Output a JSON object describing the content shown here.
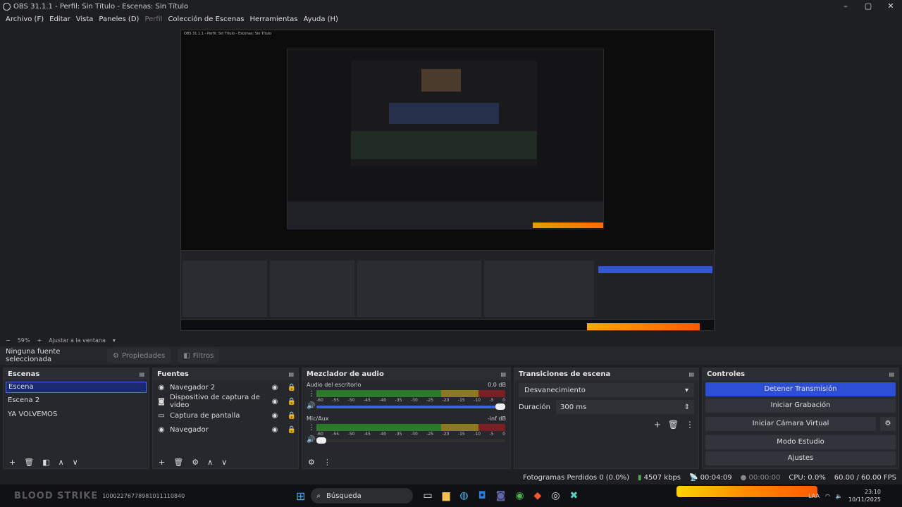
{
  "window": {
    "title": "OBS 31.1.1 - Perfil: Sin Título - Escenas: Sin Título",
    "controls": [
      "–",
      "▢",
      "✕"
    ]
  },
  "menu": [
    "Archivo (F)",
    "Editar",
    "Vista",
    "Paneles (D)",
    "Perfil",
    "Colección de Escenas",
    "Herramientas",
    "Ayuda (H)"
  ],
  "preview_bar": {
    "zoom": "59%",
    "fit": "Ajustar a la ventana"
  },
  "source_bar": {
    "no_source": "Ninguna fuente seleccionada",
    "properties": "Propiedades",
    "filters": "Filtros"
  },
  "scenes": {
    "title": "Escenas",
    "items": [
      "Escena",
      "Escena 2",
      "YA VOLVEMOS"
    ]
  },
  "sources": {
    "title": "Fuentes",
    "items": [
      "Navegador 2",
      "Dispositivo de captura de video",
      "Captura de pantalla",
      "Navegador"
    ]
  },
  "mixer": {
    "title": "Mezclador de audio",
    "channels": [
      {
        "name": "Audio del escritorio",
        "level": "0.0 dB",
        "volume": 1.0
      },
      {
        "name": "Mic/Aux",
        "level": "-inf dB",
        "volume": 0.05
      }
    ],
    "ticks": [
      "-60",
      "-55",
      "-50",
      "-45",
      "-40",
      "-35",
      "-30",
      "-25",
      "-20",
      "-15",
      "-10",
      "-5",
      "0"
    ]
  },
  "transitions": {
    "title": "Transiciones de escena",
    "selected": "Desvanecimiento",
    "duration_label": "Duración",
    "duration_value": "300 ms"
  },
  "controls": {
    "title": "Controles",
    "buttons": [
      "Detener Transmisión",
      "Iniciar Grabación",
      "Iniciar Cámara Virtual",
      "Modo Estudio",
      "Ajustes"
    ]
  },
  "status": {
    "dropped": "Fotogramas Perdidos 0 (0.0%)",
    "bitrate": "4507 kbps",
    "stream_time": "00:04:09",
    "rec_time": "00:00:00",
    "cpu": "CPU: 0.0%",
    "fps": "60.00 / 60.00 FPS"
  },
  "taskbar": {
    "overlay_left": "BLOOD STRIKE",
    "overlay_code": "10002276778981011110840",
    "search": "Búsqueda",
    "lang": "LAA",
    "time": "23:10",
    "date": "10/11/2025"
  },
  "colors": {
    "accent": "#2d4fd6",
    "bg": "#1e1f22",
    "panel": "#26282d"
  }
}
